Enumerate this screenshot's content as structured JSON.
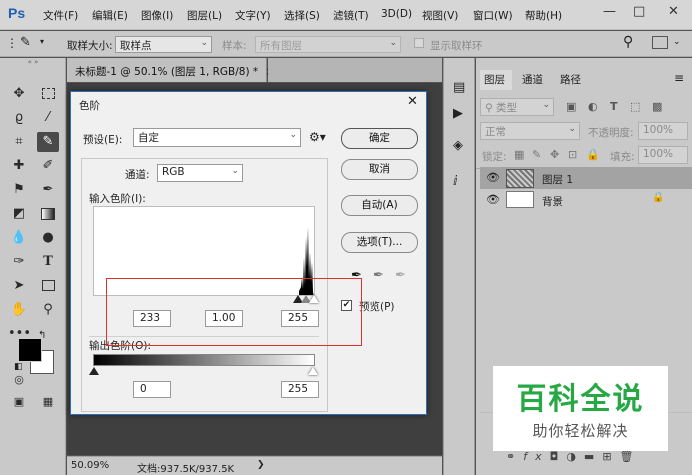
{
  "app": {
    "logo": "Ps"
  },
  "menubar": {
    "items": [
      "文件(F)",
      "编辑(E)",
      "图像(I)",
      "图层(L)",
      "文字(Y)",
      "选择(S)",
      "滤镜(T)",
      "3D(D)",
      "视图(V)",
      "窗口(W)",
      "帮助(H)"
    ],
    "window_controls": [
      "—",
      "□",
      "✕"
    ]
  },
  "options_bar": {
    "sample_size_label": "取样大小:",
    "sample_size_value": "取样点",
    "sample_label": "样本:",
    "sample_value": "所有图层",
    "show_ring_label": "显示取样环"
  },
  "document": {
    "tab_title": "未标题-1 @ 50.1% (图层 1, RGB/8) *",
    "tab_close": "×",
    "zoom": "50.09%",
    "doc_size": "文档:937.5K/937.5K",
    "status_arrow": "❯"
  },
  "layers_panel": {
    "tabs": [
      "图层",
      "通道",
      "路径"
    ],
    "filter_label": "类型",
    "blend_mode": "正常",
    "opacity_label": "不透明度:",
    "opacity_value": "100%",
    "lock_label": "锁定:",
    "fill_label": "填充:",
    "fill_value": "100%",
    "layers": [
      {
        "name": "图层 1"
      },
      {
        "name": "背景"
      }
    ]
  },
  "levels_dialog": {
    "title": "色阶",
    "close": "✕",
    "preset_label": "预设(E):",
    "preset_value": "自定",
    "channel_label": "通道:",
    "channel_value": "RGB",
    "input_levels_label": "输入色阶(I):",
    "input_values": [
      "233",
      "1.00",
      "255"
    ],
    "output_levels_label": "输出色阶(O):",
    "output_values": [
      "0",
      "255"
    ],
    "buttons": {
      "ok": "确定",
      "cancel": "取消",
      "auto": "自动(A)",
      "options": "选项(T)..."
    },
    "preview_label": "预览(P)",
    "preview_checked": true
  },
  "watermark": {
    "title": "百科全说",
    "subtitle": "助你轻松解决"
  },
  "colors": {
    "accent": "#2b6fb8",
    "watermark_green": "#27a844",
    "highlight_box": "#d9342b"
  }
}
